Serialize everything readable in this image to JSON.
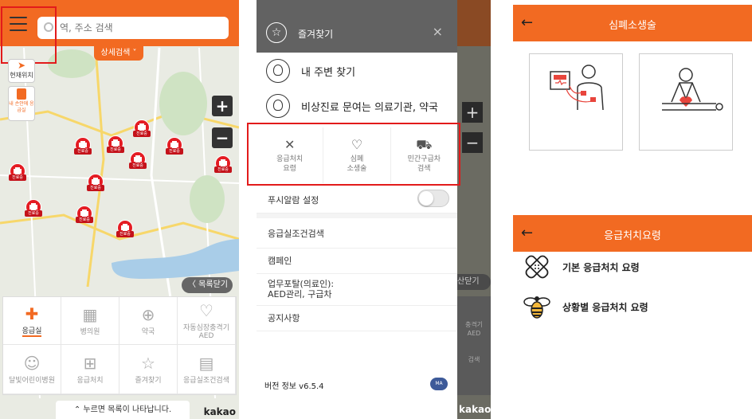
{
  "map_screen": {
    "search_placeholder": "역, 주소 검색",
    "detail_search": "상세검색",
    "current_location": "현재위치",
    "hand_button": "내 손안에 응급실",
    "zoom_in": "+",
    "zoom_out": "−",
    "marker_tag": "진료중",
    "close_list": "〈 목록닫기",
    "grid": [
      {
        "label": "응급실",
        "icon": "24h-cross-icon",
        "glyph": "✚"
      },
      {
        "label": "병의원",
        "icon": "hospital-icon",
        "glyph": "▦"
      },
      {
        "label": "약국",
        "icon": "pharmacy-icon",
        "glyph": "⊕"
      },
      {
        "label": "자동심장충격기 AED",
        "icon": "aed-heart-icon",
        "glyph": "♡"
      },
      {
        "label": "달빛어린이병원",
        "icon": "moon-child-icon",
        "glyph": "☺"
      },
      {
        "label": "응급처치",
        "icon": "firstaid-kit-icon",
        "glyph": "⊞"
      },
      {
        "label": "즐겨찾기",
        "icon": "star-icon",
        "glyph": "☆"
      },
      {
        "label": "응급실조건검색",
        "icon": "condition-search-icon",
        "glyph": "▤"
      }
    ],
    "bottom_hint": "⌃ 누르면 목록이 나타납니다.",
    "logo": "kakao"
  },
  "drawer": {
    "title": "즐겨찾기",
    "close": "×",
    "items": [
      {
        "label": "내 주변 찾기"
      },
      {
        "label": "비상진료 문여는 의료기관, 약국"
      }
    ],
    "quick": [
      {
        "label": "응급처치\n요령",
        "icon": "bandage-icon",
        "glyph": "✕"
      },
      {
        "label": "심폐\n소생술",
        "icon": "heart-hands-icon",
        "glyph": "♡"
      },
      {
        "label": "민간구급차\n검색",
        "icon": "ambulance-icon",
        "glyph": "⛟"
      }
    ],
    "push_label": "푸시알람 설정",
    "links": [
      {
        "label": "응급실조건검색"
      },
      {
        "label": "캠페인"
      },
      {
        "label": "업무포탈(의료인):\nAED관리, 구급차"
      },
      {
        "label": "공지사항"
      }
    ],
    "version": "버전 정보 v6.5.4",
    "badge": "MA",
    "side_close_list": "산닫기",
    "side_grid_text": "충격기\nAED\n\n\n검색"
  },
  "cpr_screen": {
    "back": "←",
    "title": "심폐소생술"
  },
  "firstaid_screen": {
    "back": "←",
    "title": "응급처치요령",
    "items": [
      {
        "label": "기본 응급처치 요령",
        "icon": "bandage-icon"
      },
      {
        "label": "상황별 응급처치 요령",
        "icon": "bee-icon"
      }
    ]
  },
  "colors": {
    "accent": "#f26a22",
    "highlight": "#e21b1b",
    "marker": "#e41c23"
  }
}
